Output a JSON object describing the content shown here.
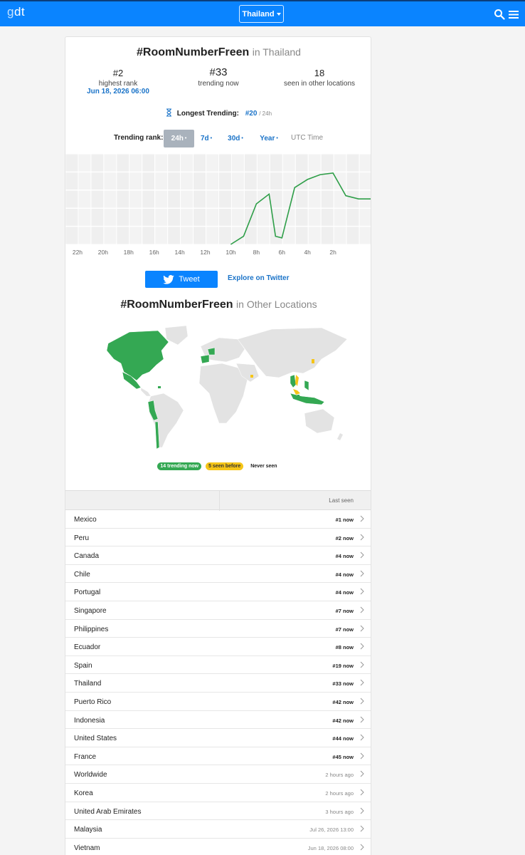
{
  "header": {
    "logo_g": "g",
    "logo_dt": "dt",
    "location": "Thailand",
    "icons": [
      "search-icon",
      "menu-icon"
    ]
  },
  "hashtag": {
    "tag": "#RoomNumberFreen",
    "in_label": "in Thailand",
    "highest_rank": "#2",
    "highest_rank_label": "highest rank",
    "highest_rank_date": "Jun 18, 2026 06:00",
    "trending_now": "#33",
    "trending_now_label": "trending now",
    "other_locations": "18",
    "other_locations_label": "seen in other locations",
    "longest_label": "Longest Trending:",
    "longest_value": "#20",
    "longest_period": "/ 24h"
  },
  "range": {
    "label": "Trending rank:",
    "options": [
      "24h",
      "7d",
      "30d",
      "Year"
    ],
    "active": "24h",
    "utc": "UTC Time"
  },
  "chart_data": {
    "type": "line",
    "x_ticks": [
      "22h",
      "20h",
      "18h",
      "16h",
      "14h",
      "12h",
      "10h",
      "8h",
      "6h",
      "4h",
      "2h"
    ],
    "series": [
      {
        "values": [
          {
            "x": 10.0,
            "y": null
          },
          {
            "x": 9.0,
            "y": 50
          },
          {
            "x": 8.0,
            "y": 30
          },
          {
            "x": 7.0,
            "y": 24
          },
          {
            "x": 6.5,
            "y": 50
          },
          {
            "x": 6.0,
            "y": 51
          },
          {
            "x": 5.0,
            "y": 20
          },
          {
            "x": 4.0,
            "y": 15
          },
          {
            "x": 3.0,
            "y": 12
          },
          {
            "x": 2.0,
            "y": 11
          },
          {
            "x": 1.0,
            "y": 25
          },
          {
            "x": 0.0,
            "y": 27
          }
        ]
      }
    ],
    "color": "#2e9e48",
    "grid": true
  },
  "actions": {
    "tweet": "Tweet",
    "explore": "Explore on Twitter"
  },
  "other_locations": {
    "tag": "#RoomNumberFreen",
    "in_label": "in Other Locations",
    "legend_trending": "14 trending now",
    "legend_seen": "5 seen before",
    "legend_never": "Never seen",
    "colors": {
      "trending": "#34a853",
      "seen": "#f5c518",
      "never": "#e3e3e3"
    }
  },
  "table": {
    "header_last_seen": "Last seen",
    "rows": [
      {
        "name": "Mexico",
        "seen": "#1 now"
      },
      {
        "name": "Peru",
        "seen": "#2 now"
      },
      {
        "name": "Canada",
        "seen": "#4 now"
      },
      {
        "name": "Chile",
        "seen": "#4 now"
      },
      {
        "name": "Portugal",
        "seen": "#4 now"
      },
      {
        "name": "Singapore",
        "seen": "#7 now"
      },
      {
        "name": "Philippines",
        "seen": "#7 now"
      },
      {
        "name": "Ecuador",
        "seen": "#8 now"
      },
      {
        "name": "Spain",
        "seen": "#19 now"
      },
      {
        "name": "Thailand",
        "seen": "#33 now"
      },
      {
        "name": "Puerto Rico",
        "seen": "#42 now"
      },
      {
        "name": "Indonesia",
        "seen": "#42 now"
      },
      {
        "name": "United States",
        "seen": "#44 now"
      },
      {
        "name": "France",
        "seen": "#45 now"
      },
      {
        "name": "Worldwide",
        "seen": "2 hours ago"
      },
      {
        "name": "Korea",
        "seen": "2 hours ago"
      },
      {
        "name": "United Arab Emirates",
        "seen": "3 hours ago"
      },
      {
        "name": "Malaysia",
        "seen": "Jul 26, 2026 13:00"
      },
      {
        "name": "Vietnam",
        "seen": "Jun 18, 2026 08:00"
      }
    ]
  }
}
